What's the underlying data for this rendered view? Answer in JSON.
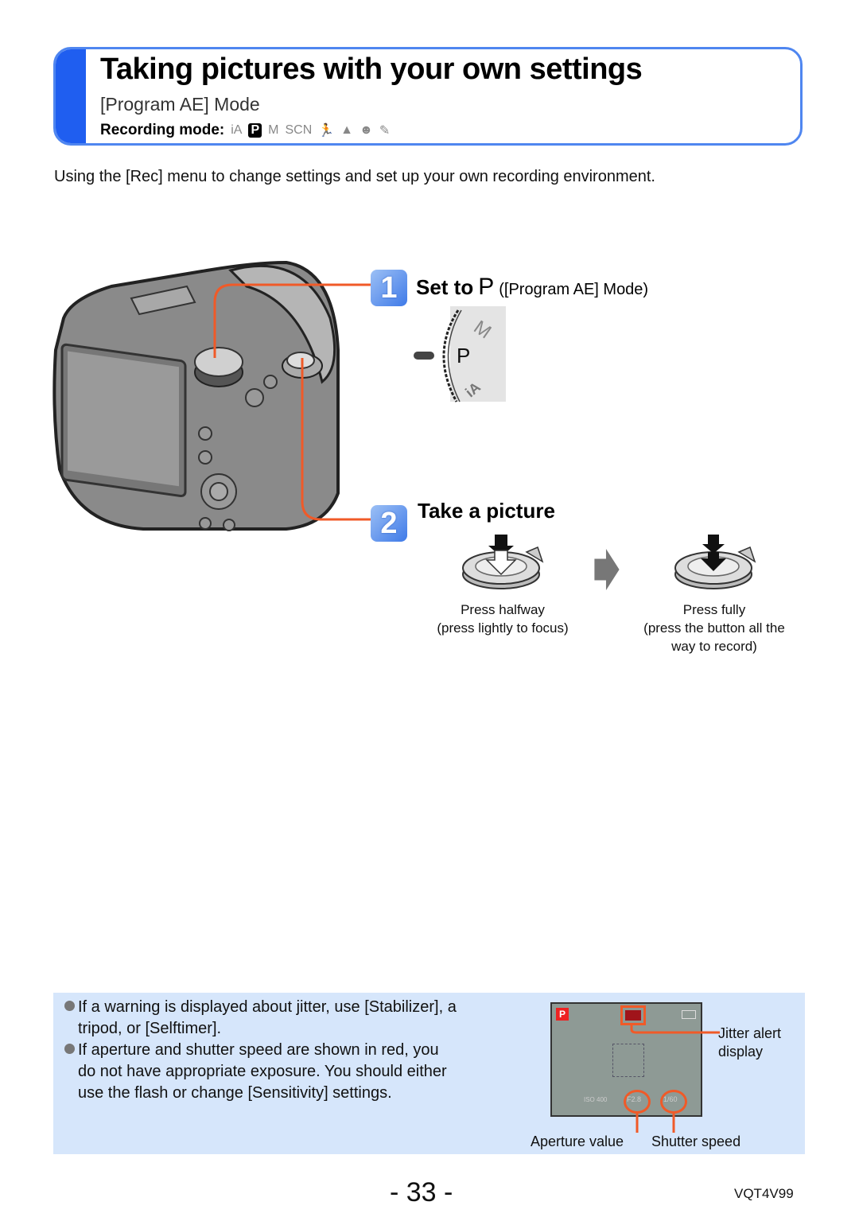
{
  "header": {
    "title": "Taking pictures with your own settings",
    "subtitle": "[Program AE] Mode",
    "recording_mode_label": "Recording mode:",
    "recording_modes": [
      {
        "icon": "intelligent-auto-icon",
        "glyph": "iA",
        "active": false
      },
      {
        "icon": "program-ae-icon",
        "glyph": "P",
        "active": true
      },
      {
        "icon": "manual-exposure-icon",
        "glyph": "M",
        "active": false
      },
      {
        "icon": "scene-mode-icon",
        "glyph": "SCN",
        "active": false
      },
      {
        "icon": "sports-icon",
        "glyph": "🏃",
        "active": false
      },
      {
        "icon": "scenery-icon",
        "glyph": "▲",
        "active": false
      },
      {
        "icon": "portrait-icon",
        "glyph": "☻",
        "active": false
      },
      {
        "icon": "creative-control-icon",
        "glyph": "✎",
        "active": false
      }
    ]
  },
  "intro": "Using the [Rec] menu to change settings and set up your own recording environment.",
  "steps": [
    {
      "number": "1",
      "title": "Set to",
      "symbol": "P",
      "aside": "([Program AE] Mode)",
      "dial_labels": {
        "top": "M",
        "center": "P",
        "bottom": "iA"
      }
    },
    {
      "number": "2",
      "title": "Take a picture",
      "actions": [
        {
          "label": "Press halfway",
          "detail": "(press lightly to focus)"
        },
        {
          "label": "Press fully",
          "detail": "(press the button all the",
          "detail2": "way to record)"
        }
      ]
    }
  ],
  "notes": {
    "items": [
      {
        "line1": "If a warning is displayed about jitter, use [Stabilizer], a",
        "line2": "tripod, or [Selftimer]."
      },
      {
        "line1": "If aperture and shutter speed are shown in red, you",
        "line2": "do not have appropriate exposure. You should either",
        "line3": "use the flash or change [Sensitivity] settings."
      }
    ],
    "lcd": {
      "mode": "P",
      "aperture": "F2.8",
      "shutter": "1/60",
      "iso": "ISO 400"
    },
    "callouts": {
      "jitter_line1": "Jitter alert",
      "jitter_line2": "display",
      "aperture": "Aperture value",
      "shutter": "Shutter speed"
    }
  },
  "footer": {
    "page_number": "- 33 -",
    "doc_code": "VQT4V99"
  },
  "colors": {
    "accent_blue": "#1f5ef0",
    "border_blue": "#4f86f0",
    "callout_orange": "#f05a28",
    "note_bg": "#d6e6fb"
  }
}
